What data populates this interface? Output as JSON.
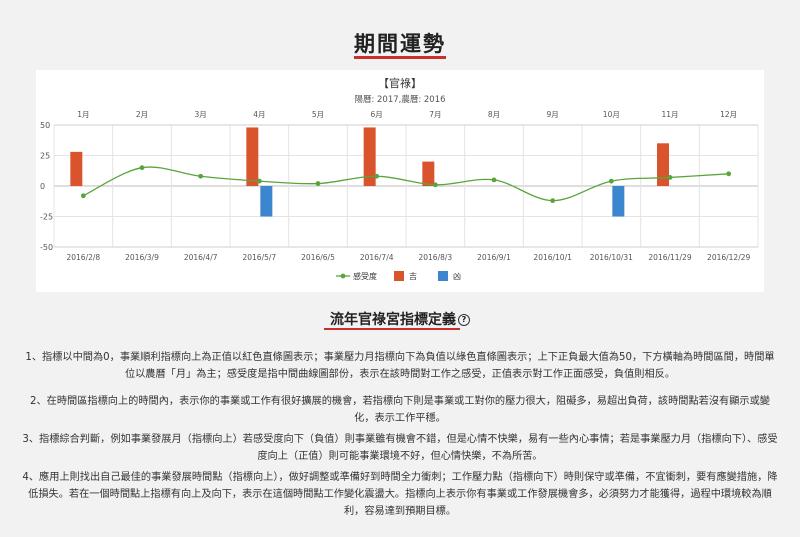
{
  "page": {
    "title": "期間運勢",
    "section_title": "流年官祿宮指標定義",
    "help_icon": "?",
    "paragraphs": [
      "1、指標以中間為0，事業順利指標向上為正值以紅色直條圖表示；事業壓力月指標向下為負值以綠色直條圖表示；上下正負最大值為50，下方橫軸為時間區間，時間單位以農曆「月」為主；感受度是指中間曲線圖部份，表示在該時間對工作之感受，正值表示對工作正面感受，負值則相反。",
      "2、在時間區指標向上的時間內，表示你的事業或工作有很好擴展的機會，若指標向下則是事業或工對你的壓力很大，阻礙多，易超出負荷，該時間點若沒有顯示或變化，表示工作平穩。",
      "3、指標綜合判斷，例如事業發展月（指標向上）若感受度向下（負值）則事業雖有機會不錯，但是心情不快樂，易有一些內心事情；若是事業壓力月（指標向下）、感受度向上（正值）則可能事業環境不好，但心情快樂，不為所苦。",
      "4、應用上則找出自己最佳的事業發展時間點（指標向上），做好調整或準備好到時間全力衝刺；工作壓力點（指標向下）時則保守或準備，不宜衝刺，要有應變措施，降低損失。若在一個時間點上指標有向上及向下，表示在這個時間點工作變化震盪大。指標向上表示你有事業或工作發展機會多，必須努力才能獲得，過程中環境較為順利，容易達到預期目標。"
    ]
  },
  "chart_data": {
    "type": "bar",
    "title": "【官祿】",
    "subtitle": "陽曆: 2017,農曆: 2016",
    "top_categories": [
      "1月",
      "2月",
      "3月",
      "4月",
      "5月",
      "6月",
      "7月",
      "8月",
      "9月",
      "10月",
      "11月",
      "12月"
    ],
    "categories": [
      "2016/2/8",
      "2016/3/9",
      "2016/4/7",
      "2016/5/7",
      "2016/6/5",
      "2016/7/4",
      "2016/8/3",
      "2016/9/1",
      "2016/10/1",
      "2016/10/31",
      "2016/11/29",
      "2016/12/29"
    ],
    "ylim": [
      -50,
      50
    ],
    "yticks": [
      50,
      25,
      0,
      -25,
      -50
    ],
    "grid": true,
    "legend_position": "bottom",
    "series": [
      {
        "name": "感受度",
        "kind": "line",
        "color": "#5aa53b",
        "values": [
          -8,
          15,
          8,
          4,
          2,
          8,
          1,
          5,
          -12,
          4,
          7,
          10
        ]
      },
      {
        "name": "吉",
        "kind": "bar",
        "color": "#d9542c",
        "values": [
          28,
          0,
          0,
          48,
          0,
          48,
          20,
          0,
          0,
          0,
          35,
          0
        ]
      },
      {
        "name": "凶",
        "kind": "bar",
        "color": "#3b86cf",
        "values": [
          0,
          0,
          0,
          -25,
          0,
          0,
          0,
          0,
          0,
          -25,
          0,
          0
        ]
      }
    ]
  }
}
